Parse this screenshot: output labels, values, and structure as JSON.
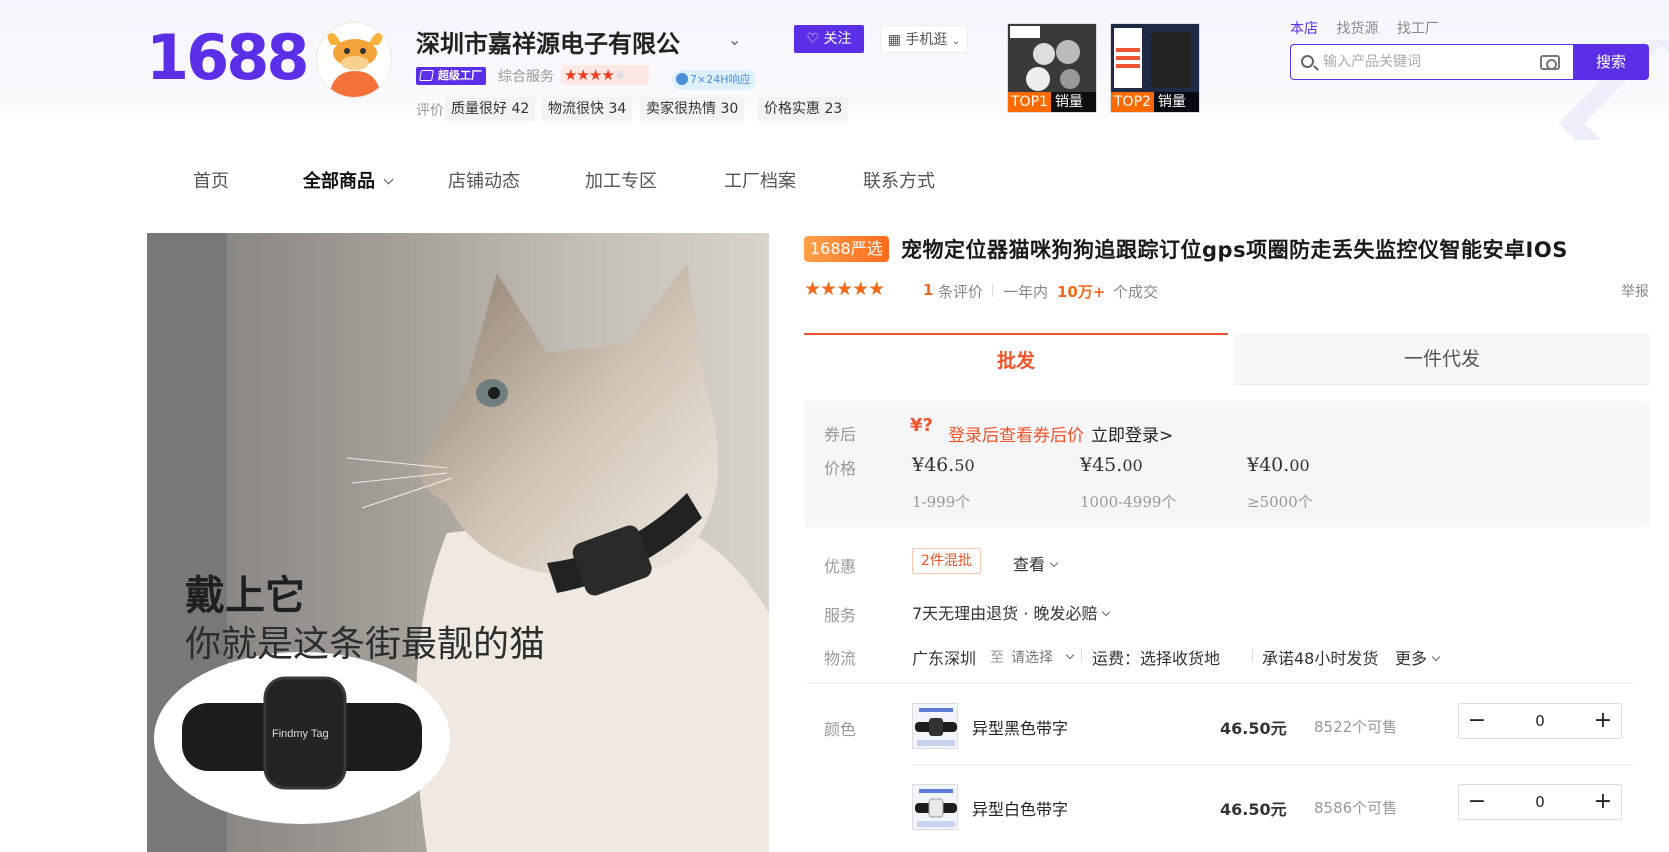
{
  "header": {
    "logo": "1688",
    "company_name": "深圳市嘉祥源电子有限公",
    "badge_super_factory": "超级工厂",
    "service_label": "综合服务",
    "service_stars": "★★★★",
    "service_stars_dim": "★",
    "response_badge": "7×24H响应",
    "rating_label": "评价",
    "ratings": [
      "质量很好 42",
      "物流很快 34",
      "卖家很热情 30",
      "价格实惠 23"
    ],
    "follow_label": "关注",
    "mobile_label": "手机逛",
    "top_products": [
      {
        "rank": "TOP1",
        "label": "销量"
      },
      {
        "rank": "TOP2",
        "label": "销量"
      }
    ],
    "search_tabs": [
      "本店",
      "找货源",
      "找工厂"
    ],
    "search_placeholder": "输入产品关键词",
    "search_button": "搜索"
  },
  "nav": {
    "items": [
      "首页",
      "全部商品",
      "店铺动态",
      "加工专区",
      "工厂档案",
      "联系方式"
    ],
    "active_index": 1
  },
  "product": {
    "image_text_1": "戴上它",
    "image_text_2": "你就是这条街最靓的猫",
    "tag_text": "Findmy Tag",
    "yanxuan": "1688严选",
    "title": "宠物定位器猫咪狗狗追跟踪订位gps项圈防走丢失监控仪智能安卓IOS",
    "stars": "★★★★★",
    "review_count": "1",
    "review_label": "条评价",
    "year_label": "一年内",
    "deals_count": "10万+",
    "deals_label": "个成交",
    "report": "举报"
  },
  "tabs": {
    "wholesale": "批发",
    "dropship": "一件代发"
  },
  "pricing": {
    "coupon_label": "券后",
    "coupon_icon": "¥?",
    "coupon_text": "登录后查看券后价",
    "coupon_login": "立即登录>",
    "price_label": "价格",
    "tiers": [
      {
        "int": "¥46.",
        "dec": "50",
        "range": "1-999个"
      },
      {
        "int": "¥45.",
        "dec": "00",
        "range": "1000-4999个"
      },
      {
        "int": "¥40.",
        "dec": "00",
        "range": "≥5000个"
      }
    ]
  },
  "details": {
    "promo_label": "优惠",
    "promo_tag": "2件混批",
    "promo_view": "查看",
    "service_label": "服务",
    "service_text": "7天无理由退货 · 晚发必赔",
    "logistics_label": "物流",
    "origin": "广东深圳",
    "to": "至",
    "select": "请选择",
    "freight": "运费：选择收货地",
    "promise": "承诺48小时发货",
    "more": "更多",
    "color_label": "颜色"
  },
  "skus": [
    {
      "name": "异型黑色带字",
      "price": "46.50元",
      "stock": "8522个可售",
      "qty": "0"
    },
    {
      "name": "异型白色带字",
      "price": "46.50元",
      "stock": "8586个可售",
      "qty": "0"
    }
  ],
  "colors": {
    "brand": "#5b2ee8",
    "accent": "#f0542a"
  }
}
